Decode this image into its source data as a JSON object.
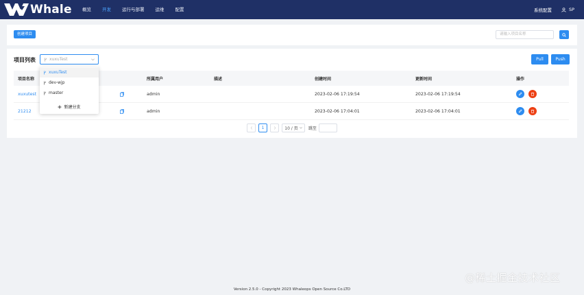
{
  "app": {
    "logo_text": "Whale"
  },
  "nav": {
    "items": [
      {
        "label": "概览",
        "active": false
      },
      {
        "label": "开发",
        "active": true
      },
      {
        "label": "运行与部署",
        "active": false
      },
      {
        "label": "运维",
        "active": false
      },
      {
        "label": "配置",
        "active": false
      }
    ],
    "system_config": "系统配置",
    "user": "SP"
  },
  "toolbar": {
    "create_label": "创建项目",
    "search_placeholder": "请输入项目名称"
  },
  "list": {
    "title": "项目列表",
    "branch_selected": "xuxuTest",
    "pull_label": "Pull",
    "push_label": "Push",
    "columns": [
      "项目名称",
      "所属用户",
      "描述",
      "创建时间",
      "更新时间",
      "操作"
    ],
    "rows": [
      {
        "name": "xuxutest",
        "user": "admin",
        "desc": "",
        "created": "2023-02-06 17:19:54",
        "updated": "2023-02-06 17:19:54"
      },
      {
        "name": "21212",
        "user": "admin",
        "desc": "",
        "created": "2023-02-06 17:04:01",
        "updated": "2023-02-06 17:04:01"
      }
    ]
  },
  "branch_dropdown": {
    "items": [
      {
        "label": "xuxuTest",
        "selected": true
      },
      {
        "label": "dev-wjp",
        "selected": false
      },
      {
        "label": "master",
        "selected": false
      }
    ],
    "new_branch": "新建分支"
  },
  "pagination": {
    "current_page": "1",
    "page_size": "10 / 页",
    "jump_label": "跳至"
  },
  "footer": {
    "text": "Version 2.5.0 - Copyright 2023 Whaleops Open Source Co.LTD"
  },
  "watermark": "@稀土掘金技术社区",
  "colors": {
    "nav_bg": "#1f3066",
    "primary": "#2d8cf0",
    "danger": "#ed4014"
  }
}
